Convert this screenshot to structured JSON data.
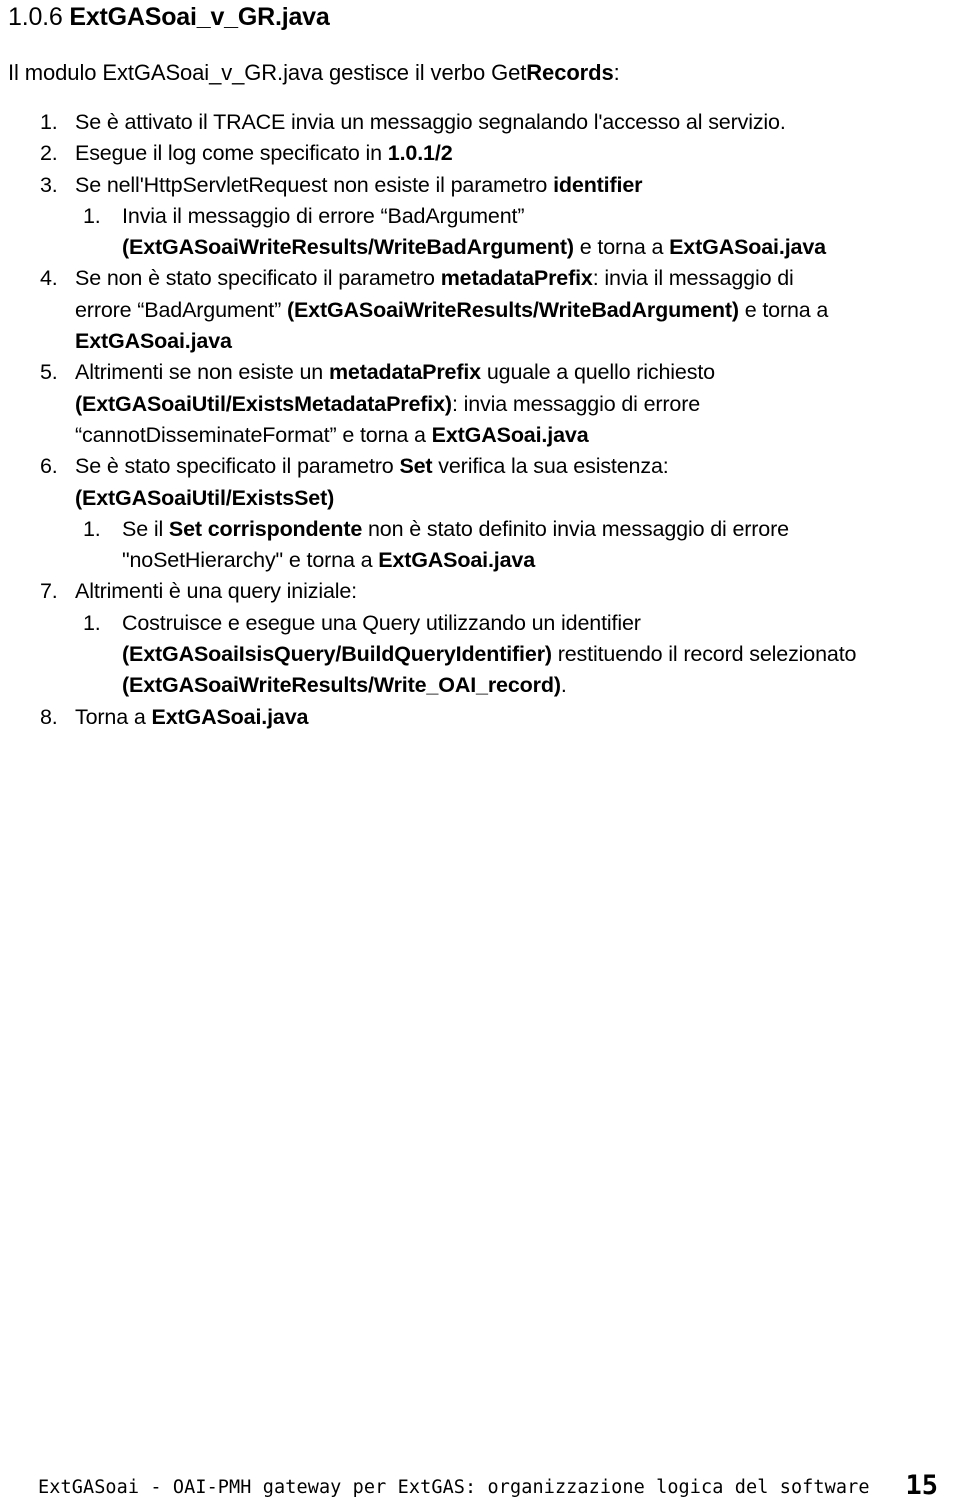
{
  "document": {
    "heading": {
      "number": "1.0.6",
      "title": "ExtGASoai_v_GR.java"
    },
    "intro": {
      "before": "Il modulo ExtGASoai_v_GR.java gestisce il verbo ",
      "verb_plain": "Get",
      "verb_bold": "Records",
      "after": ":"
    },
    "items": [
      {
        "marker": "1.",
        "level": 1,
        "lines": [
          [
            {
              "t": "Se è attivato il TRACE invia un messaggio segnalando l'accesso al servizio.",
              "b": false
            }
          ]
        ]
      },
      {
        "marker": "2.",
        "level": 1,
        "lines": [
          [
            {
              "t": "Esegue il log come specificato in ",
              "b": false
            },
            {
              "t": "1.0.1/2",
              "b": true
            }
          ]
        ]
      },
      {
        "marker": "3.",
        "level": 1,
        "lines": [
          [
            {
              "t": "Se nell'HttpServletRequest  non esiste il parametro ",
              "b": false
            },
            {
              "t": "identifier",
              "b": true
            }
          ]
        ]
      },
      {
        "marker": "1.",
        "level": 2,
        "lines": [
          [
            {
              "t": "Invia il messaggio di errore “BadArgument”",
              "b": false
            }
          ],
          [
            {
              "t": "(ExtGASoaiWriteResults/WriteBadArgument)",
              "b": true
            },
            {
              "t": " e torna a  ",
              "b": false
            },
            {
              "t": "ExtGASoai.java",
              "b": true
            }
          ]
        ]
      },
      {
        "marker": "4.",
        "level": 1,
        "lines": [
          [
            {
              "t": "Se non è stato specificato il parametro  ",
              "b": false
            },
            {
              "t": "metadataPrefix",
              "b": true
            },
            {
              "t": ": invia il messaggio di",
              "b": false
            }
          ],
          [
            {
              "t": "errore “BadArgument” ",
              "b": false
            },
            {
              "t": "(ExtGASoaiWriteResults/WriteBadArgument)",
              "b": true
            },
            {
              "t": " e torna a",
              "b": false
            }
          ],
          [
            {
              "t": "ExtGASoai.java",
              "b": true
            }
          ]
        ]
      },
      {
        "marker": "5.",
        "level": 1,
        "lines": [
          [
            {
              "t": "Altrimenti  se non esiste un  ",
              "b": false
            },
            {
              "t": "metadataPrefix",
              "b": true
            },
            {
              "t": " uguale a quello richiesto",
              "b": false
            }
          ],
          [
            {
              "t": "(ExtGASoaiUtil/ExistsMetadataPrefix)",
              "b": true
            },
            {
              "t": ": invia messaggio di errore",
              "b": false
            }
          ],
          [
            {
              "t": "“cannotDisseminateFormat” e torna a ",
              "b": false
            },
            {
              "t": "ExtGASoai.java",
              "b": true
            }
          ]
        ]
      },
      {
        "marker": "6.",
        "level": 1,
        "lines": [
          [
            {
              "t": "Se è stato specificato il parametro ",
              "b": false
            },
            {
              "t": "Set",
              "b": true
            },
            {
              "t": " verifica la sua esistenza:",
              "b": false
            }
          ],
          [
            {
              "t": "(ExtGASoaiUtil/ExistsSet)",
              "b": true
            }
          ]
        ]
      },
      {
        "marker": "1.",
        "level": 2,
        "lines": [
          [
            {
              "t": "Se il  ",
              "b": false
            },
            {
              "t": "Set corrispondente",
              "b": true
            },
            {
              "t": " non è stato definito invia messaggio di errore",
              "b": false
            }
          ],
          [
            {
              "t": "\"noSetHierarchy\" e torna a  ",
              "b": false
            },
            {
              "t": "ExtGASoai.java",
              "b": true
            }
          ]
        ]
      },
      {
        "marker": "7.",
        "level": 1,
        "lines": [
          [
            {
              "t": "Altrimenti è una query iniziale:",
              "b": false
            }
          ]
        ]
      },
      {
        "marker": "1.",
        "level": 2,
        "lines": [
          [
            {
              "t": "Costruisce e esegue una Query utilizzando un  identifier",
              "b": false
            }
          ],
          [
            {
              "t": "(ExtGASoaiIsisQuery/BuildQueryIdentifier)",
              "b": true
            },
            {
              "t": " restituendo il record selezionato",
              "b": false
            }
          ],
          [
            {
              "t": "(ExtGASoaiWriteResults/Write_OAI_record)",
              "b": true
            },
            {
              "t": ".",
              "b": false
            }
          ]
        ]
      },
      {
        "marker": "8.",
        "level": 1,
        "lines": [
          [
            {
              "t": "Torna a  ",
              "b": false
            },
            {
              "t": "ExtGASoai.java",
              "b": true
            }
          ]
        ]
      }
    ]
  },
  "footer": {
    "text": "ExtGASoai - OAI-PMH gateway per ExtGAS: organizzazione logica del software",
    "page_number": "15"
  }
}
